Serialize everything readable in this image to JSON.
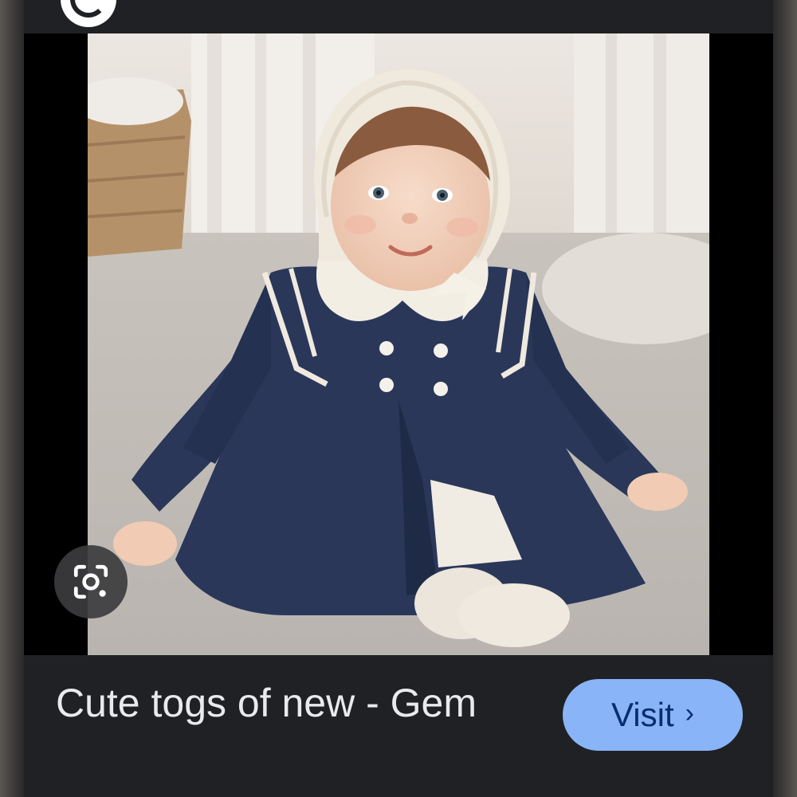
{
  "result": {
    "caption": "Cute togs of new - Gem",
    "visit_label": "Visit",
    "visit_chevron": "›"
  },
  "icons": {
    "lens": "google-lens-icon",
    "source_logo": "source-logo-icon"
  },
  "colors": {
    "background": "#202124",
    "caption_text": "#e8eaed",
    "visit_button": "#8ab4f8",
    "visit_text": "#062e6f"
  }
}
